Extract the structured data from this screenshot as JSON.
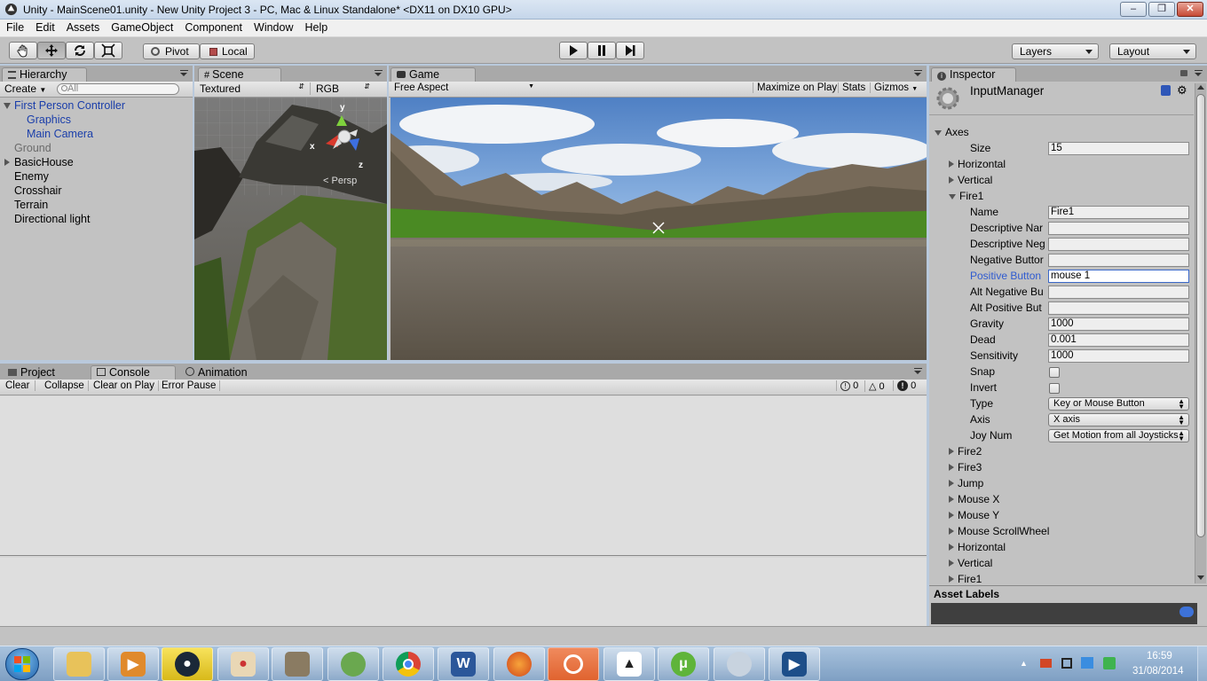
{
  "window": {
    "title": "Unity - MainScene01.unity - New Unity Project 3 - PC, Mac & Linux Standalone* <DX11 on DX10 GPU>",
    "min": "–",
    "max": "❐",
    "close": "✕"
  },
  "menu": [
    "File",
    "Edit",
    "Assets",
    "GameObject",
    "Component",
    "Window",
    "Help"
  ],
  "toolbar": {
    "pivot": "Pivot",
    "local": "Local",
    "layers": "Layers",
    "layout": "Layout"
  },
  "hierarchy": {
    "tab": "Hierarchy",
    "create": "Create",
    "search_placeholder": "All",
    "items": [
      {
        "label": "First Person Controller",
        "state": "selected"
      },
      {
        "label": "Graphics",
        "state": "child"
      },
      {
        "label": "Main Camera",
        "state": "child"
      },
      {
        "label": "Ground",
        "state": "inactive"
      },
      {
        "label": "BasicHouse",
        "state": "collapsed"
      },
      {
        "label": "Enemy",
        "state": "normal"
      },
      {
        "label": "Crosshair",
        "state": "normal"
      },
      {
        "label": "Terrain",
        "state": "normal"
      },
      {
        "label": "Directional light",
        "state": "normal"
      }
    ]
  },
  "scene": {
    "tab": "Scene",
    "render_mode": "Textured",
    "channel": "RGB",
    "gizmo_label": "Persp",
    "axes": {
      "y": "y",
      "x": "x",
      "z": "z"
    }
  },
  "game": {
    "tab": "Game",
    "aspect": "Free Aspect",
    "maximize": "Maximize on Play",
    "stats": "Stats",
    "gizmos": "Gizmos"
  },
  "console": {
    "tabs": [
      "Project",
      "Console",
      "Animation"
    ],
    "buttons": [
      "Clear",
      "Collapse",
      "Clear on Play",
      "Error Pause"
    ],
    "counts": {
      "log": "0",
      "warn": "0",
      "error": "0"
    }
  },
  "inspector": {
    "tab": "Inspector",
    "component": "InputManager",
    "axes_label": "Axes",
    "size_label": "Size",
    "size_value": "15",
    "collapsed_before": [
      "Horizontal",
      "Vertical"
    ],
    "expanded_label": "Fire1",
    "fields": [
      {
        "label": "Name",
        "value": "Fire1",
        "type": "text"
      },
      {
        "label": "Descriptive Nar",
        "value": "",
        "type": "text"
      },
      {
        "label": "Descriptive Neg",
        "value": "",
        "type": "text"
      },
      {
        "label": "Negative Buttor",
        "value": "",
        "type": "text"
      },
      {
        "label": "Positive Button",
        "value": "mouse 1",
        "type": "text",
        "focused": true
      },
      {
        "label": "Alt Negative Bu",
        "value": "",
        "type": "text"
      },
      {
        "label": "Alt Positive But",
        "value": "",
        "type": "text"
      },
      {
        "label": "Gravity",
        "value": "1000",
        "type": "text"
      },
      {
        "label": "Dead",
        "value": "0.001",
        "type": "text"
      },
      {
        "label": "Sensitivity",
        "value": "1000",
        "type": "text"
      },
      {
        "label": "Snap",
        "value": "",
        "type": "check"
      },
      {
        "label": "Invert",
        "value": "",
        "type": "check"
      },
      {
        "label": "Type",
        "value": "Key or Mouse Button",
        "type": "select"
      },
      {
        "label": "Axis",
        "value": "X axis",
        "type": "select"
      },
      {
        "label": "Joy Num",
        "value": "Get Motion from all Joysticks",
        "type": "select"
      }
    ],
    "collapsed_after": [
      "Fire2",
      "Fire3",
      "Jump",
      "Mouse X",
      "Mouse Y",
      "Mouse ScrollWheel",
      "Horizontal",
      "Vertical",
      "Fire1"
    ],
    "asset_labels": "Asset Labels"
  },
  "taskbar": {
    "time": "16:59",
    "date": "31/08/2014",
    "apps": [
      "explorer",
      "media-player",
      "steam",
      "paint",
      "gimp",
      "game",
      "chrome",
      "word",
      "firefox",
      "origin",
      "unity",
      "utorrent",
      "app",
      "media"
    ]
  },
  "colors": {
    "selected_text": "#1a3eaa",
    "panel_bg": "#c2c2c2",
    "focus_label": "#2f5bd0"
  }
}
